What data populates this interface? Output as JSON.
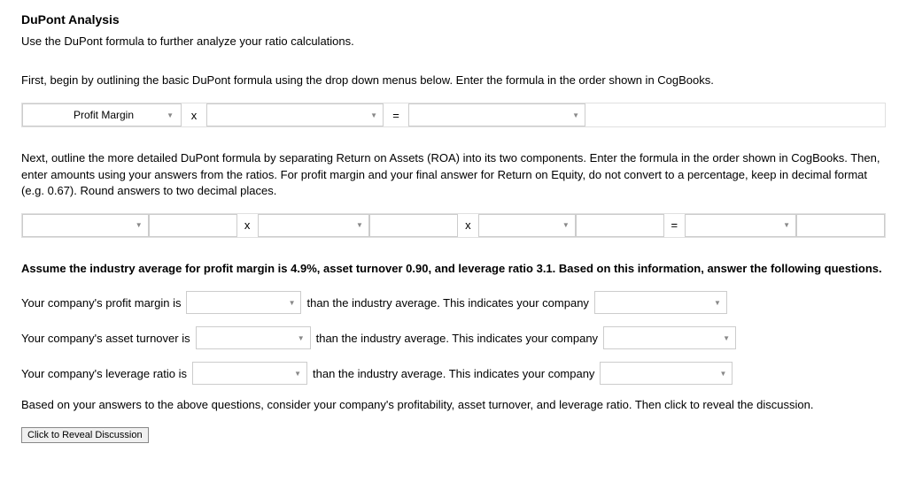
{
  "heading": "DuPont Analysis",
  "intro": "Use the DuPont formula to further analyze your ratio calculations.",
  "step1_text": "First, begin by outlining the basic DuPont formula using the drop down menus below. Enter the formula in the order shown in CogBooks.",
  "formula1": {
    "slot1": "Profit Margin",
    "op1": "x",
    "slot2": "",
    "op2": "=",
    "slot3": ""
  },
  "step2_text": "Next, outline the more detailed DuPont formula by separating Return on Assets (ROA) into its two components. Enter the formula in the order shown in CogBooks. Then, enter amounts using your answers from the ratios. For profit margin and your final answer for Return on Equity, do not convert to a percentage, keep in decimal format (e.g. 0.67). Round answers to two decimal places.",
  "formula2": {
    "slot1": "",
    "num1": "",
    "op1": "x",
    "slot2": "",
    "num2": "",
    "op2": "x",
    "slot3": "",
    "num3": "",
    "op3": "=",
    "slot4": "",
    "num4": ""
  },
  "assume_text": "Assume the industry average for profit margin is 4.9%, asset turnover 0.90, and leverage ratio 3.1. Based on this information, answer the following questions.",
  "q1": {
    "pre": "Your company's profit margin is",
    "mid": "than the industry average. This indicates your company"
  },
  "q2": {
    "pre": "Your company's asset turnover is",
    "mid": "than the industry average. This indicates your company"
  },
  "q3": {
    "pre": "Your company's leverage ratio is",
    "mid": "than the industry average. This indicates your company"
  },
  "closing_text": "Based on your answers to the above questions, consider your company's profitability, asset turnover, and leverage ratio. Then click to reveal the discussion.",
  "reveal_label": "Click to Reveal Discussion"
}
